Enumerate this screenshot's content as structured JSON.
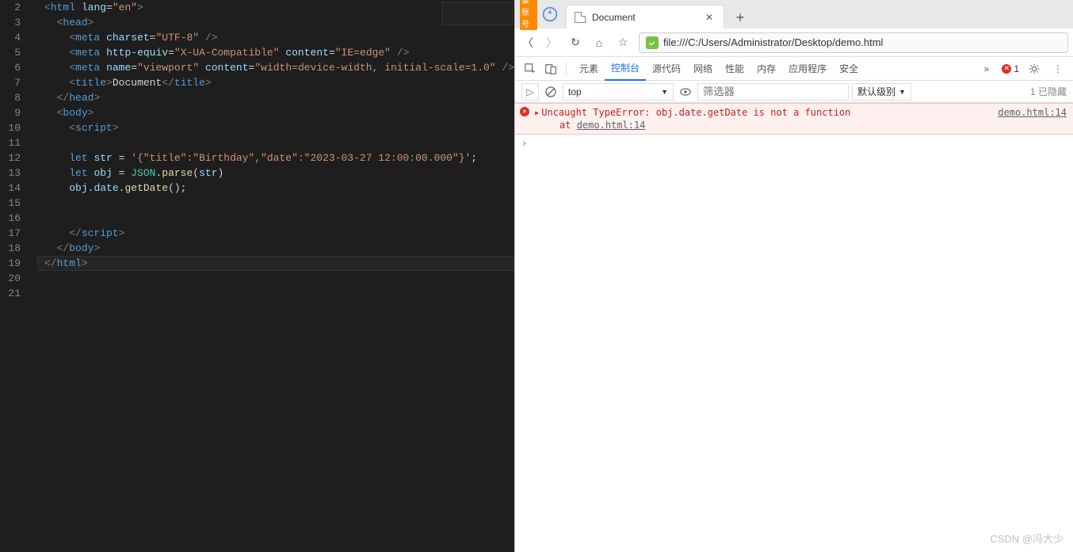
{
  "editor": {
    "line_numbers": [
      "2",
      "3",
      "4",
      "5",
      "6",
      "7",
      "8",
      "9",
      "10",
      "11",
      "12",
      "13",
      "14",
      "15",
      "16",
      "17",
      "18",
      "19",
      "20",
      "21"
    ],
    "lines": [
      {
        "indent": 0,
        "tokens": [
          {
            "c": "t-tag",
            "t": "<"
          },
          {
            "c": "t-el",
            "t": "html"
          },
          {
            "c": "t-pln",
            "t": " "
          },
          {
            "c": "t-attr",
            "t": "lang"
          },
          {
            "c": "t-pln",
            "t": "="
          },
          {
            "c": "t-str",
            "t": "\"en\""
          },
          {
            "c": "t-tag",
            "t": ">"
          }
        ]
      },
      {
        "indent": 1,
        "tokens": [
          {
            "c": "t-tag",
            "t": "<"
          },
          {
            "c": "t-el",
            "t": "head"
          },
          {
            "c": "t-tag",
            "t": ">"
          }
        ]
      },
      {
        "indent": 2,
        "tokens": [
          {
            "c": "t-tag",
            "t": "<"
          },
          {
            "c": "t-el",
            "t": "meta"
          },
          {
            "c": "t-pln",
            "t": " "
          },
          {
            "c": "t-attr",
            "t": "charset"
          },
          {
            "c": "t-pln",
            "t": "="
          },
          {
            "c": "t-str",
            "t": "\"UTF-8\""
          },
          {
            "c": "t-pln",
            "t": " "
          },
          {
            "c": "t-tag",
            "t": "/>"
          }
        ]
      },
      {
        "indent": 2,
        "tokens": [
          {
            "c": "t-tag",
            "t": "<"
          },
          {
            "c": "t-el",
            "t": "meta"
          },
          {
            "c": "t-pln",
            "t": " "
          },
          {
            "c": "t-attr",
            "t": "http-equiv"
          },
          {
            "c": "t-pln",
            "t": "="
          },
          {
            "c": "t-str",
            "t": "\"X-UA-Compatible\""
          },
          {
            "c": "t-pln",
            "t": " "
          },
          {
            "c": "t-attr",
            "t": "content"
          },
          {
            "c": "t-pln",
            "t": "="
          },
          {
            "c": "t-str",
            "t": "\"IE=edge\""
          },
          {
            "c": "t-pln",
            "t": " "
          },
          {
            "c": "t-tag",
            "t": "/>"
          }
        ]
      },
      {
        "indent": 2,
        "tokens": [
          {
            "c": "t-tag",
            "t": "<"
          },
          {
            "c": "t-el",
            "t": "meta"
          },
          {
            "c": "t-pln",
            "t": " "
          },
          {
            "c": "t-attr",
            "t": "name"
          },
          {
            "c": "t-pln",
            "t": "="
          },
          {
            "c": "t-str",
            "t": "\"viewport\""
          },
          {
            "c": "t-pln",
            "t": " "
          },
          {
            "c": "t-attr",
            "t": "content"
          },
          {
            "c": "t-pln",
            "t": "="
          },
          {
            "c": "t-str",
            "t": "\"width=device-width, initial-scale=1.0\""
          },
          {
            "c": "t-pln",
            "t": " "
          },
          {
            "c": "t-tag",
            "t": "/>"
          }
        ]
      },
      {
        "indent": 2,
        "tokens": [
          {
            "c": "t-tag",
            "t": "<"
          },
          {
            "c": "t-el",
            "t": "title"
          },
          {
            "c": "t-tag",
            "t": ">"
          },
          {
            "c": "t-pln",
            "t": "Document"
          },
          {
            "c": "t-tag",
            "t": "</"
          },
          {
            "c": "t-el",
            "t": "title"
          },
          {
            "c": "t-tag",
            "t": ">"
          }
        ]
      },
      {
        "indent": 1,
        "tokens": [
          {
            "c": "t-tag",
            "t": "</"
          },
          {
            "c": "t-el",
            "t": "head"
          },
          {
            "c": "t-tag",
            "t": ">"
          }
        ]
      },
      {
        "indent": 1,
        "tokens": [
          {
            "c": "t-tag",
            "t": "<"
          },
          {
            "c": "t-el",
            "t": "body"
          },
          {
            "c": "t-tag",
            "t": ">"
          }
        ]
      },
      {
        "indent": 2,
        "tokens": [
          {
            "c": "t-tag",
            "t": "<"
          },
          {
            "c": "t-el",
            "t": "script"
          },
          {
            "c": "t-tag",
            "t": ">"
          }
        ]
      },
      {
        "indent": 2,
        "tokens": []
      },
      {
        "indent": 2,
        "tokens": [
          {
            "c": "t-key",
            "t": "let"
          },
          {
            "c": "t-pln",
            "t": " "
          },
          {
            "c": "t-var",
            "t": "str"
          },
          {
            "c": "t-pln",
            "t": " = "
          },
          {
            "c": "t-str",
            "t": "'{\"title\":\"Birthday\",\"date\":\"2023-03-27 12:00:00.000\"}'"
          },
          {
            "c": "t-pln",
            "t": ";"
          }
        ]
      },
      {
        "indent": 2,
        "tokens": [
          {
            "c": "t-key",
            "t": "let"
          },
          {
            "c": "t-pln",
            "t": " "
          },
          {
            "c": "t-var",
            "t": "obj"
          },
          {
            "c": "t-pln",
            "t": " = "
          },
          {
            "c": "t-typ",
            "t": "JSON"
          },
          {
            "c": "t-pln",
            "t": "."
          },
          {
            "c": "t-fn",
            "t": "parse"
          },
          {
            "c": "t-pln",
            "t": "("
          },
          {
            "c": "t-var",
            "t": "str"
          },
          {
            "c": "t-pln",
            "t": ")"
          }
        ]
      },
      {
        "indent": 2,
        "tokens": [
          {
            "c": "t-var",
            "t": "obj"
          },
          {
            "c": "t-pln",
            "t": "."
          },
          {
            "c": "t-prop",
            "t": "date"
          },
          {
            "c": "t-pln",
            "t": "."
          },
          {
            "c": "t-fn",
            "t": "getDate"
          },
          {
            "c": "t-pln",
            "t": "();"
          }
        ]
      },
      {
        "indent": 2,
        "tokens": []
      },
      {
        "indent": 2,
        "tokens": []
      },
      {
        "indent": 2,
        "tokens": [
          {
            "c": "t-tag",
            "t": "</"
          },
          {
            "c": "t-el",
            "t": "script"
          },
          {
            "c": "t-tag",
            "t": ">"
          }
        ]
      },
      {
        "indent": 1,
        "tokens": [
          {
            "c": "t-tag",
            "t": "</"
          },
          {
            "c": "t-el",
            "t": "body"
          },
          {
            "c": "t-tag",
            "t": ">"
          }
        ]
      },
      {
        "indent": 0,
        "hl": true,
        "tokens": [
          {
            "c": "t-tag",
            "t": "</"
          },
          {
            "c": "t-el",
            "t": "html"
          },
          {
            "c": "t-tag",
            "t": ">"
          }
        ]
      },
      {
        "indent": 0,
        "tokens": []
      },
      {
        "indent": 0,
        "tokens": []
      }
    ]
  },
  "browser": {
    "login_badge": "登录账号",
    "tab_title": "Document",
    "url": "file:///C:/Users/Administrator/Desktop/demo.html",
    "devtools": {
      "tabs": [
        "元素",
        "控制台",
        "源代码",
        "网络",
        "性能",
        "内存",
        "应用程序",
        "安全"
      ],
      "active_tab": 1,
      "more_label": "»",
      "error_count": "1",
      "context": "top",
      "filter_placeholder": "筛选器",
      "level": "默认级别",
      "hidden_count": "1 已隐藏"
    },
    "console": {
      "error_msg": "Uncaught TypeError: obj.date.getDate is not a function",
      "error_loc": "demo.html:14",
      "error_at_prefix": "at ",
      "error_at_link": "demo.html:14"
    }
  },
  "watermark": "CSDN @冯大少"
}
